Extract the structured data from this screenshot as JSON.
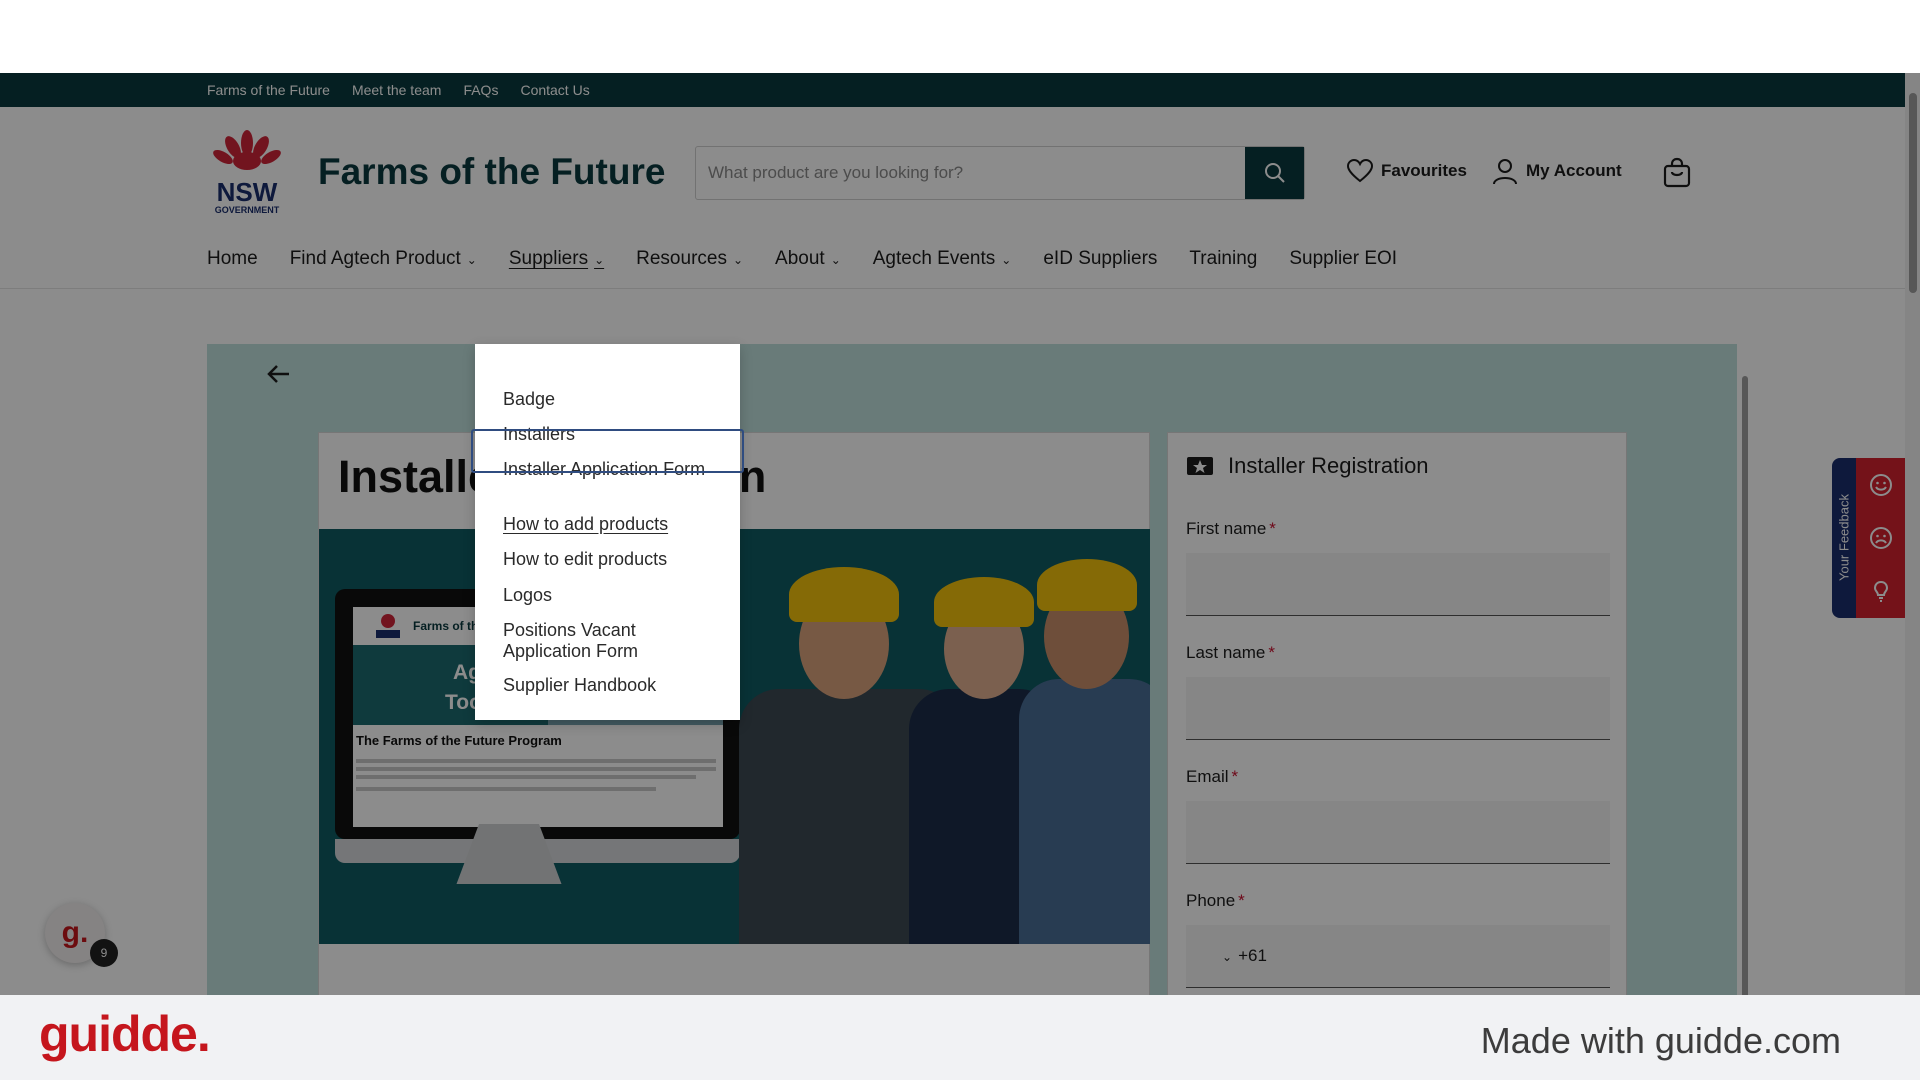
{
  "utility_links": [
    "Farms of the Future",
    "Meet the team",
    "FAQs",
    "Contact Us"
  ],
  "header": {
    "logo_text": "NSW",
    "logo_subtext": "GOVERNMENT",
    "brand": "Farms of the Future",
    "search_placeholder": "What product are you looking for?",
    "favourites": "Favourites",
    "account": "My Account"
  },
  "nav": {
    "items": [
      {
        "label": "Home"
      },
      {
        "label": "Find Agtech Product"
      },
      {
        "label": "Suppliers"
      },
      {
        "label": "Resources"
      },
      {
        "label": "About"
      },
      {
        "label": "Agtech Events"
      },
      {
        "label": "eID Suppliers"
      },
      {
        "label": "Training"
      },
      {
        "label": "Supplier EOI"
      }
    ]
  },
  "dropdown": {
    "items": [
      "Badge",
      "Installers",
      "Installer Application Form",
      "How to add products",
      "How to edit products",
      "Logos",
      "Positions Vacant Application Form",
      "Supplier Handbook"
    ],
    "highlighted": "How to add products"
  },
  "main": {
    "heading": "Installer Application",
    "banner": {
      "screen_brand": "Farms of th",
      "screen_title_1": "Agtech",
      "screen_title_2": "Toolbox",
      "screen_heading": "The Farms of the Future Program"
    }
  },
  "form": {
    "title": "Installer Registration",
    "fields": [
      {
        "label": "First name",
        "required": "*"
      },
      {
        "label": "Last name",
        "required": "*"
      },
      {
        "label": "Email",
        "required": "*"
      },
      {
        "label": "Phone",
        "required": "*"
      }
    ],
    "phone_code": "+61"
  },
  "feedback": {
    "tab_label": "Your Feedback"
  },
  "guidde_badge": {
    "letter": "g.",
    "count": "9"
  },
  "footer": {
    "logo": "guidde.",
    "made_with": "Made with guidde.com"
  },
  "colors": {
    "primary": "#0a3a3e",
    "accent": "#c8102e",
    "guidde_red": "#c5161d"
  }
}
